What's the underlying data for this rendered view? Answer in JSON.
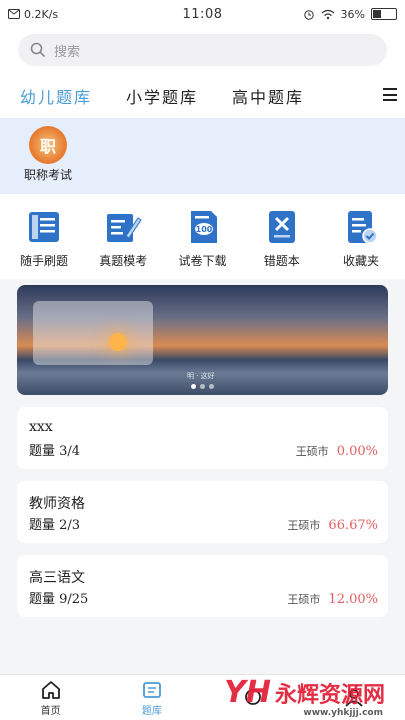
{
  "status": {
    "speed": "0.2K/s",
    "time": "11:08",
    "battery": "36%"
  },
  "search": {
    "placeholder": "搜索"
  },
  "tabs": [
    {
      "label": "幼儿题库",
      "active": true
    },
    {
      "label": "小学题库",
      "active": false
    },
    {
      "label": "高中题库",
      "active": false
    }
  ],
  "category": {
    "label": "职称考试",
    "logo_text": "职"
  },
  "features": [
    {
      "label": "随手刷题",
      "icon": "book-icon"
    },
    {
      "label": "真题模考",
      "icon": "edit-icon"
    },
    {
      "label": "试卷下载",
      "icon": "score-paper-icon"
    },
    {
      "label": "错题本",
      "icon": "wrong-book-icon"
    },
    {
      "label": "收藏夹",
      "icon": "favorites-icon"
    }
  ],
  "banner": {
    "hint": "明 · 这好"
  },
  "records": [
    {
      "title": "xxx",
      "count": "题量 3/4",
      "user": "王硕市",
      "percent": "0.00%"
    },
    {
      "title": "教师资格",
      "count": "题量 2/3",
      "user": "王硕市",
      "percent": "66.67%"
    },
    {
      "title": "高三语文",
      "count": "题量 9/25",
      "user": "王硕市",
      "percent": "12.00%"
    }
  ],
  "tabbar": [
    {
      "label": "首页",
      "icon": "home-icon",
      "active": false
    },
    {
      "label": "题库",
      "icon": "question-bank-icon",
      "active": true
    },
    {
      "label": "",
      "icon": "ring-icon",
      "active": false
    },
    {
      "label": "",
      "icon": "profile-icon",
      "active": false
    }
  ],
  "watermark": {
    "logo": "YH",
    "name": "永辉资源网",
    "url": "www.yhkjjj.com"
  },
  "colors": {
    "accent": "#4a9cd8",
    "percent": "#e06060",
    "icon_blue": "#2f73c9"
  }
}
